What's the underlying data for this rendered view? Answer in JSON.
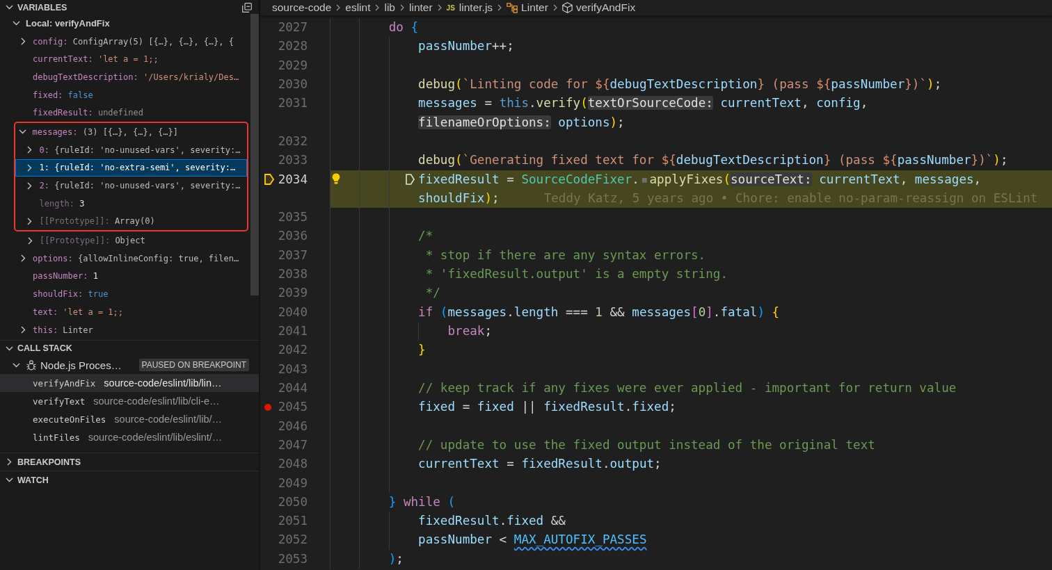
{
  "sidebar": {
    "variables": {
      "title": "VARIABLES",
      "expanded": true,
      "items": [
        {
          "kind": "scope",
          "label": "Local: verifyAndFix",
          "expanded": true,
          "selected": false,
          "dimmed": false,
          "children": [
            {
              "kind": "object",
              "name": "config:",
              "value": "ConfigArray(5) [{…}, {…}, {…}, {",
              "expanded": false,
              "selected": false,
              "dimmed": false
            },
            {
              "kind": "string",
              "name": "currentText:",
              "value": "'let a = 1;;",
              "selected": false,
              "dimmed": false
            },
            {
              "kind": "string",
              "name": "debugTextDescription:",
              "value": "'/Users/krialy/Des…",
              "selected": false,
              "dimmed": false
            },
            {
              "kind": "boolean",
              "name": "fixed:",
              "value": "false",
              "selected": false,
              "dimmed": false
            },
            {
              "kind": "undefined",
              "name": "fixedResult:",
              "value": "undefined",
              "selected": false,
              "dimmed": false
            },
            {
              "kind": "object",
              "name": "messages:",
              "value": "(3) [{…}, {…}, {…}]",
              "expanded": true,
              "selected": false,
              "dimmed": false,
              "children": [
                {
                  "kind": "object",
                  "name": "0:",
                  "value": "{ruleId: 'no-unused-vars', severity:…",
                  "expanded": false,
                  "selected": false,
                  "dimmed": false
                },
                {
                  "kind": "object",
                  "name": "1:",
                  "value": "{ruleId: 'no-extra-semi', severity:…",
                  "expanded": false,
                  "selected": true,
                  "dimmed": false
                },
                {
                  "kind": "object",
                  "name": "2:",
                  "value": "{ruleId: 'no-unused-vars', severity:…",
                  "expanded": false,
                  "selected": false,
                  "dimmed": false
                },
                {
                  "kind": "number",
                  "name": "length:",
                  "value": "3",
                  "selected": false,
                  "dimmed": true
                },
                {
                  "kind": "object",
                  "name": "[[Prototype]]:",
                  "value": "Array(0)",
                  "expanded": false,
                  "selected": false,
                  "dimmed": true
                },
                {
                  "kind": "object",
                  "name": "[[Prototype]]:",
                  "value": "Object",
                  "expanded": false,
                  "selected": false,
                  "dimmed": true
                }
              ]
            },
            {
              "kind": "object",
              "name": "options:",
              "value": "{allowInlineConfig: true, filen…",
              "expanded": false,
              "selected": false,
              "dimmed": false
            },
            {
              "kind": "number",
              "name": "passNumber:",
              "value": "1",
              "selected": false,
              "dimmed": false
            },
            {
              "kind": "boolean",
              "name": "shouldFix:",
              "value": "true",
              "selected": false,
              "dimmed": false
            },
            {
              "kind": "string",
              "name": "text:",
              "value": "'let a = 1;;",
              "selected": false,
              "dimmed": false
            },
            {
              "kind": "object",
              "name": "this:",
              "value": "Linter",
              "expanded": false,
              "selected": false,
              "dimmed": false
            }
          ]
        }
      ]
    },
    "call_stack": {
      "title": "CALL STACK",
      "expanded": true,
      "sessions": [
        {
          "label": "Node.js Proces…",
          "status": "PAUSED ON BREAKPOINT",
          "expanded": true,
          "frames": [
            {
              "function": "verifyAndFix",
              "path": "source-code/eslint/lib/lin…",
              "selected": true
            },
            {
              "function": "verifyText",
              "path": "source-code/eslint/lib/cli-e…",
              "selected": false
            },
            {
              "function": "executeOnFiles",
              "path": "source-code/eslint/lib/…",
              "selected": false
            },
            {
              "function": "lintFiles",
              "path": "source-code/eslint/lib/eslint/…",
              "selected": false
            }
          ]
        }
      ]
    },
    "breakpoints": {
      "title": "BREAKPOINTS",
      "expanded": false
    },
    "watch": {
      "title": "WATCH",
      "expanded": true
    }
  },
  "editor": {
    "breadcrumbs": [
      {
        "label": "source-code",
        "kind": "folder"
      },
      {
        "label": "eslint",
        "kind": "folder"
      },
      {
        "label": "lib",
        "kind": "folder"
      },
      {
        "label": "linter",
        "kind": "folder"
      },
      {
        "label": "linter.js",
        "kind": "file",
        "badge": "JS"
      },
      {
        "label": "Linter",
        "kind": "class"
      },
      {
        "label": "verifyAndFix",
        "kind": "method"
      }
    ],
    "lines": [
      {
        "number": "2027",
        "current": false,
        "breakpoint": false,
        "lightbulb": false,
        "rows": [
          {
            "tokens": [
              {
                "text": "do",
                "kind": "control"
              },
              {
                "text": " {",
                "kind": "b3"
              }
            ]
          }
        ],
        "children": [
          {
            "number": "2028",
            "current": false,
            "breakpoint": false,
            "lightbulb": false,
            "rows": [
              {
                "tokens": [
                  {
                    "text": "passNumber",
                    "kind": "var"
                  },
                  {
                    "text": "++;",
                    "kind": "plain"
                  }
                ]
              }
            ]
          },
          {
            "number": "2029",
            "current": false,
            "breakpoint": false,
            "lightbulb": false
          },
          {
            "number": "2030",
            "current": false,
            "breakpoint": false,
            "lightbulb": false,
            "rows": [
              {
                "tokens": [
                  {
                    "text": "debug",
                    "kind": "fn"
                  },
                  {
                    "text": "(",
                    "kind": "b1"
                  },
                  {
                    "text": "`Linting code for ",
                    "kind": "str"
                  },
                  {
                    "text": "${",
                    "kind": "tpl"
                  },
                  {
                    "text": "debugTextDescription",
                    "kind": "var"
                  },
                  {
                    "text": "}",
                    "kind": "tpl"
                  },
                  {
                    "text": " (pass ",
                    "kind": "str"
                  },
                  {
                    "text": "${",
                    "kind": "tpl"
                  },
                  {
                    "text": "passNumber",
                    "kind": "var"
                  },
                  {
                    "text": "}",
                    "kind": "tpl"
                  },
                  {
                    "text": ")`",
                    "kind": "str"
                  },
                  {
                    "text": ")",
                    "kind": "b1"
                  },
                  {
                    "text": ";",
                    "kind": "plain"
                  }
                ]
              }
            ]
          },
          {
            "number": "2031",
            "current": false,
            "breakpoint": false,
            "lightbulb": false,
            "rows": [
              {
                "tokens": [
                  {
                    "text": "messages",
                    "kind": "var"
                  },
                  {
                    "text": " = ",
                    "kind": "plain"
                  },
                  {
                    "text": "this",
                    "kind": "this"
                  },
                  {
                    "text": ".",
                    "kind": "plain"
                  },
                  {
                    "text": "verify",
                    "kind": "fn"
                  },
                  {
                    "text": "(",
                    "kind": "b1"
                  },
                  {
                    "text": "textOrSourceCode:",
                    "kind": "hint"
                  },
                  {
                    "text": " currentText",
                    "kind": "var"
                  },
                  {
                    "text": ", ",
                    "kind": "plain"
                  },
                  {
                    "text": "config",
                    "kind": "var"
                  },
                  {
                    "text": ",",
                    "kind": "plain"
                  }
                ]
              },
              {
                "tokens": [
                  {
                    "text": "filenameOrOptions:",
                    "kind": "hint"
                  },
                  {
                    "text": " options",
                    "kind": "var"
                  },
                  {
                    "text": ")",
                    "kind": "b1"
                  },
                  {
                    "text": ";",
                    "kind": "plain"
                  }
                ]
              }
            ]
          },
          {
            "number": "2032",
            "current": false,
            "breakpoint": false,
            "lightbulb": false
          },
          {
            "number": "2033",
            "current": false,
            "breakpoint": false,
            "lightbulb": false,
            "rows": [
              {
                "tokens": [
                  {
                    "text": "debug",
                    "kind": "fn"
                  },
                  {
                    "text": "(",
                    "kind": "b1"
                  },
                  {
                    "text": "`Generating fixed text for ",
                    "kind": "str"
                  },
                  {
                    "text": "${",
                    "kind": "tpl"
                  },
                  {
                    "text": "debugTextDescription",
                    "kind": "var"
                  },
                  {
                    "text": "}",
                    "kind": "tpl"
                  },
                  {
                    "text": " (pass ",
                    "kind": "str"
                  },
                  {
                    "text": "${",
                    "kind": "tpl"
                  },
                  {
                    "text": "passNumber",
                    "kind": "var"
                  },
                  {
                    "text": "}",
                    "kind": "tpl"
                  },
                  {
                    "text": ")`",
                    "kind": "str"
                  },
                  {
                    "text": ")",
                    "kind": "b1"
                  },
                  {
                    "text": ";",
                    "kind": "plain"
                  }
                ]
              }
            ]
          },
          {
            "number": "2034",
            "current": true,
            "breakpoint": false,
            "lightbulb": true,
            "rows": [
              {
                "tokens": [
                  {
                    "text": "fixedResult",
                    "kind": "var"
                  },
                  {
                    "text": " = ",
                    "kind": "plain"
                  },
                  {
                    "text": "SourceCodeFixer",
                    "kind": "class"
                  },
                  {
                    "text": ".",
                    "kind": "plain"
                  },
                  {
                    "text": "▪",
                    "kind": "marker"
                  },
                  {
                    "text": "applyFixes",
                    "kind": "fn"
                  },
                  {
                    "text": "(",
                    "kind": "b1"
                  },
                  {
                    "text": "sourceText:",
                    "kind": "hint"
                  },
                  {
                    "text": " currentText",
                    "kind": "var"
                  },
                  {
                    "text": ", ",
                    "kind": "plain"
                  },
                  {
                    "text": "messages",
                    "kind": "var"
                  },
                  {
                    "text": ",",
                    "kind": "plain"
                  }
                ]
              },
              {
                "tokens": [
                  {
                    "text": "shouldFix",
                    "kind": "var"
                  },
                  {
                    "text": ")",
                    "kind": "b1"
                  },
                  {
                    "text": ";",
                    "kind": "plain"
                  },
                  {
                    "text": "Teddy Katz, 5 years ago • Chore: enable no-param-reassign on ESLint",
                    "kind": "blame"
                  }
                ]
              }
            ]
          },
          {
            "number": "2035",
            "current": false,
            "breakpoint": false,
            "lightbulb": false
          },
          {
            "number": "2036",
            "current": false,
            "breakpoint": false,
            "lightbulb": false,
            "rows": [
              {
                "tokens": [
                  {
                    "text": "/*",
                    "kind": "comment"
                  }
                ]
              }
            ]
          },
          {
            "number": "2037",
            "current": false,
            "breakpoint": false,
            "lightbulb": false,
            "rows": [
              {
                "tokens": [
                  {
                    "text": " * stop if there are any syntax errors.",
                    "kind": "comment"
                  }
                ]
              }
            ]
          },
          {
            "number": "2038",
            "current": false,
            "breakpoint": false,
            "lightbulb": false,
            "rows": [
              {
                "tokens": [
                  {
                    "text": " * 'fixedResult.output' is a empty string.",
                    "kind": "comment"
                  }
                ]
              }
            ]
          },
          {
            "number": "2039",
            "current": false,
            "breakpoint": false,
            "lightbulb": false,
            "rows": [
              {
                "tokens": [
                  {
                    "text": " */",
                    "kind": "comment"
                  }
                ]
              }
            ]
          },
          {
            "number": "2040",
            "current": false,
            "breakpoint": false,
            "lightbulb": false,
            "rows": [
              {
                "tokens": [
                  {
                    "text": "if",
                    "kind": "control"
                  },
                  {
                    "text": " (",
                    "kind": "b3"
                  },
                  {
                    "text": "messages",
                    "kind": "var"
                  },
                  {
                    "text": ".",
                    "kind": "plain"
                  },
                  {
                    "text": "length",
                    "kind": "var"
                  },
                  {
                    "text": " === ",
                    "kind": "plain"
                  },
                  {
                    "text": "1",
                    "kind": "num"
                  },
                  {
                    "text": " && ",
                    "kind": "plain"
                  },
                  {
                    "text": "messages",
                    "kind": "var"
                  },
                  {
                    "text": "[",
                    "kind": "b2"
                  },
                  {
                    "text": "0",
                    "kind": "num"
                  },
                  {
                    "text": "]",
                    "kind": "b2"
                  },
                  {
                    "text": ".",
                    "kind": "plain"
                  },
                  {
                    "text": "fatal",
                    "kind": "var"
                  },
                  {
                    "text": ")",
                    "kind": "b3"
                  },
                  {
                    "text": " {",
                    "kind": "b1"
                  }
                ]
              }
            ],
            "children": [
              {
                "number": "2041",
                "current": false,
                "breakpoint": false,
                "lightbulb": false,
                "rows": [
                  {
                    "tokens": [
                      {
                        "text": "break",
                        "kind": "control"
                      },
                      {
                        "text": ";",
                        "kind": "plain"
                      }
                    ]
                  }
                ]
              }
            ]
          },
          {
            "number": "2042",
            "current": false,
            "breakpoint": false,
            "lightbulb": false,
            "rows": [
              {
                "tokens": [
                  {
                    "text": "}",
                    "kind": "b1"
                  }
                ]
              }
            ]
          },
          {
            "number": "2043",
            "current": false,
            "breakpoint": false,
            "lightbulb": false
          },
          {
            "number": "2044",
            "current": false,
            "breakpoint": false,
            "lightbulb": false,
            "rows": [
              {
                "tokens": [
                  {
                    "text": "// keep track if any fixes were ever applied - important for return value",
                    "kind": "comment"
                  }
                ]
              }
            ]
          },
          {
            "number": "2045",
            "current": false,
            "breakpoint": true,
            "lightbulb": false,
            "rows": [
              {
                "tokens": [
                  {
                    "text": "fixed",
                    "kind": "var"
                  },
                  {
                    "text": " = ",
                    "kind": "plain"
                  },
                  {
                    "text": "fixed",
                    "kind": "var"
                  },
                  {
                    "text": " || ",
                    "kind": "plain"
                  },
                  {
                    "text": "fixedResult",
                    "kind": "var"
                  },
                  {
                    "text": ".",
                    "kind": "plain"
                  },
                  {
                    "text": "fixed",
                    "kind": "var"
                  },
                  {
                    "text": ";",
                    "kind": "plain"
                  }
                ]
              }
            ]
          },
          {
            "number": "2046",
            "current": false,
            "breakpoint": false,
            "lightbulb": false
          },
          {
            "number": "2047",
            "current": false,
            "breakpoint": false,
            "lightbulb": false,
            "rows": [
              {
                "tokens": [
                  {
                    "text": "// update to use the fixed output instead of the original text",
                    "kind": "comment"
                  }
                ]
              }
            ]
          },
          {
            "number": "2048",
            "current": false,
            "breakpoint": false,
            "lightbulb": false,
            "rows": [
              {
                "tokens": [
                  {
                    "text": "currentText",
                    "kind": "var"
                  },
                  {
                    "text": " = ",
                    "kind": "plain"
                  },
                  {
                    "text": "fixedResult",
                    "kind": "var"
                  },
                  {
                    "text": ".",
                    "kind": "plain"
                  },
                  {
                    "text": "output",
                    "kind": "var"
                  },
                  {
                    "text": ";",
                    "kind": "plain"
                  }
                ]
              }
            ]
          },
          {
            "number": "2049",
            "current": false,
            "breakpoint": false,
            "lightbulb": false
          }
        ]
      },
      {
        "number": "2050",
        "current": false,
        "breakpoint": false,
        "lightbulb": false,
        "rows": [
          {
            "tokens": [
              {
                "text": "}",
                "kind": "b3"
              },
              {
                "text": " while",
                "kind": "control"
              },
              {
                "text": " (",
                "kind": "b3"
              }
            ]
          }
        ],
        "children": [
          {
            "number": "2051",
            "current": false,
            "breakpoint": false,
            "lightbulb": false,
            "rows": [
              {
                "tokens": [
                  {
                    "text": "fixedResult",
                    "kind": "var"
                  },
                  {
                    "text": ".",
                    "kind": "plain"
                  },
                  {
                    "text": "fixed",
                    "kind": "var"
                  },
                  {
                    "text": " &&",
                    "kind": "plain"
                  }
                ]
              }
            ]
          },
          {
            "number": "2052",
            "current": false,
            "breakpoint": false,
            "lightbulb": false,
            "rows": [
              {
                "tokens": [
                  {
                    "text": "passNumber",
                    "kind": "var"
                  },
                  {
                    "text": " < ",
                    "kind": "plain"
                  },
                  {
                    "text": "MAX_AUTOFIX_PASSES",
                    "kind": "flagged"
                  }
                ]
              }
            ]
          }
        ]
      },
      {
        "number": "2053",
        "current": false,
        "breakpoint": false,
        "lightbulb": false,
        "rows": [
          {
            "tokens": [
              {
                "text": ")",
                "kind": "b3"
              },
              {
                "text": ";",
                "kind": "plain"
              }
            ]
          }
        ]
      }
    ]
  }
}
